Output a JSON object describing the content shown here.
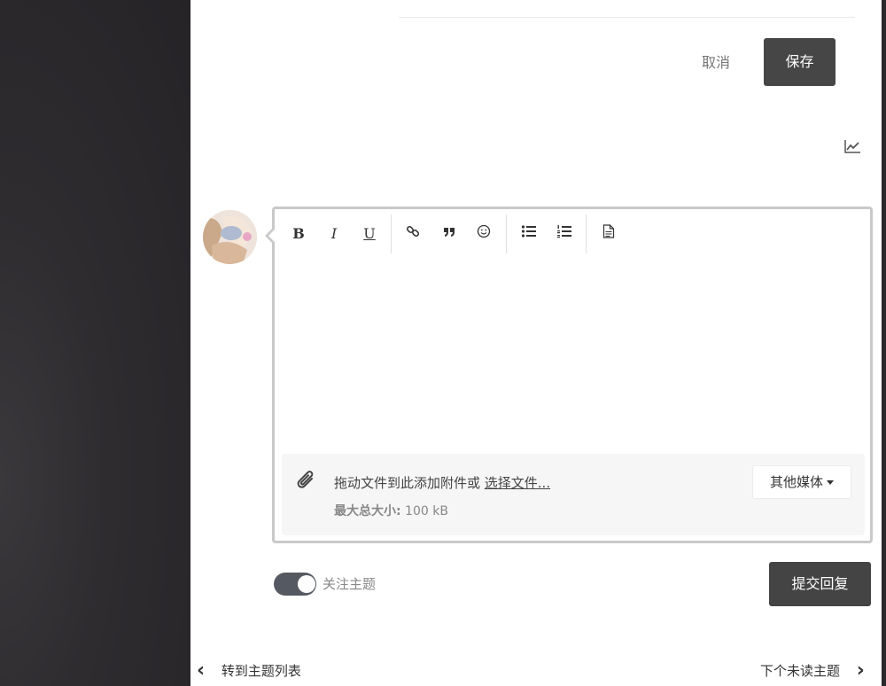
{
  "edit_actions": {
    "cancel_label": "取消",
    "save_label": "保存"
  },
  "toolbar": {
    "bold": "B",
    "italic": "I",
    "underline": "U"
  },
  "attachments": {
    "drop_text": "拖动文件到此添加附件或 ",
    "choose_files": "选择文件...",
    "limit_label": "最大总大小:",
    "limit_value": " 100 kB",
    "other_media": "其他媒体"
  },
  "reply": {
    "watch_label": "关注主题",
    "watch_enabled": true,
    "submit_label": "提交回复"
  },
  "navigation": {
    "prev_label": "转到主题列表",
    "next_label": "下个未读主题"
  }
}
